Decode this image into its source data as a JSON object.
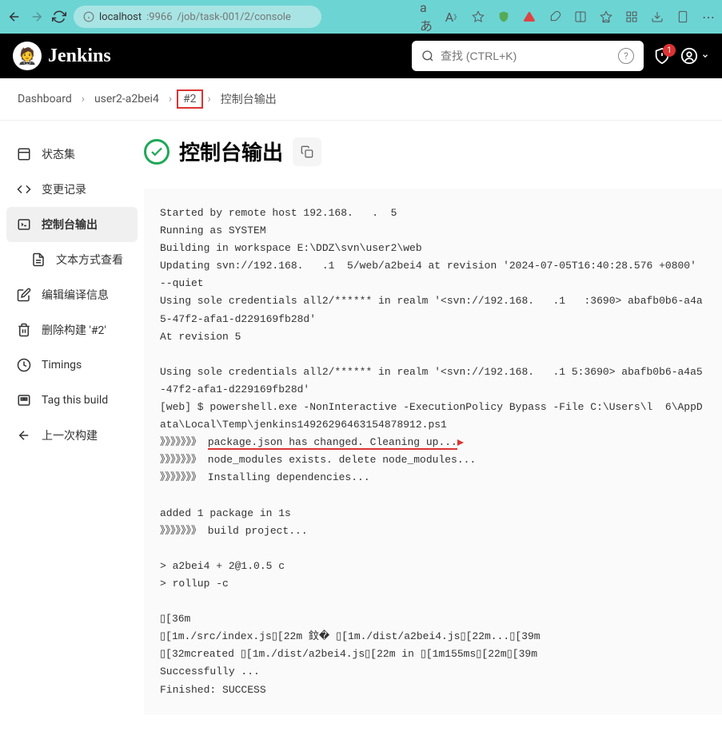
{
  "browser": {
    "url_domain": "localhost",
    "url_port": ":9966",
    "url_path": "/job/task-001/2/console"
  },
  "header": {
    "title": "Jenkins",
    "search_placeholder": "查找 (CTRL+K)",
    "alert_count": "1"
  },
  "breadcrumb": {
    "dashboard": "Dashboard",
    "job": "user2-a2bei4",
    "build": "#2",
    "page": "控制台输出"
  },
  "sidebar": {
    "status": "状态集",
    "changes": "变更记录",
    "console": "控制台输出",
    "textview": "文本方式查看",
    "editbuild": "编辑编译信息",
    "deletebuild": "删除构建 '#2'",
    "timings": "Timings",
    "tagbuild": "Tag this build",
    "prevbuild": "上一次构建"
  },
  "content": {
    "title": "控制台输出"
  },
  "console": {
    "line1": "Started by remote host 192.168.   .  5",
    "line2": "Running as SYSTEM",
    "line3": "Building in workspace E:\\DDZ\\svn\\user2\\web",
    "line4": "Updating svn://192.168.   .1  5/web/a2bei4 at revision '2024-07-05T16:40:28.576 +0800' --quiet",
    "line5": "Using sole credentials all2/****** in realm '<svn://192.168.   .1   :3690> abafb0b6-a4a5-47f2-afa1-d229169fb28d'",
    "line6": "At revision 5",
    "line7": "",
    "line8": "Using sole credentials all2/****** in realm '<svn://192.168.   .1 5:3690> abafb0b6-a4a5-47f2-afa1-d229169fb28d'",
    "line9": "[web] $ powershell.exe -NonInteractive -ExecutionPolicy Bypass -File C:\\Users\\l  6\\AppData\\Local\\Temp\\jenkins14926296463154878912.ps1",
    "line10_prefix": "》》》》》》》 ",
    "line10": "package.json has changed. Cleaning up...",
    "line11": "》》》》》》》 node_modules exists. delete node_modules...",
    "line12": "》》》》》》》 Installing dependencies...",
    "line13": "",
    "line14": "added 1 package in 1s",
    "line15": "》》》》》》》 build project...",
    "line16": "",
    "line17": "> a2bei4 + 2@1.0.5 c",
    "line18": "> rollup -c",
    "line19": "",
    "line20": "▯[36m",
    "line21": "▯[1m./src/index.js▯[22m 鈫� ▯[1m./dist/a2bei4.js▯[22m...▯[39m",
    "line22": "▯[32mcreated ▯[1m./dist/a2bei4.js▯[22m in ▯[1m155ms▯[22m▯[39m",
    "line23": "Successfully ...",
    "line24": "Finished: SUCCESS"
  }
}
